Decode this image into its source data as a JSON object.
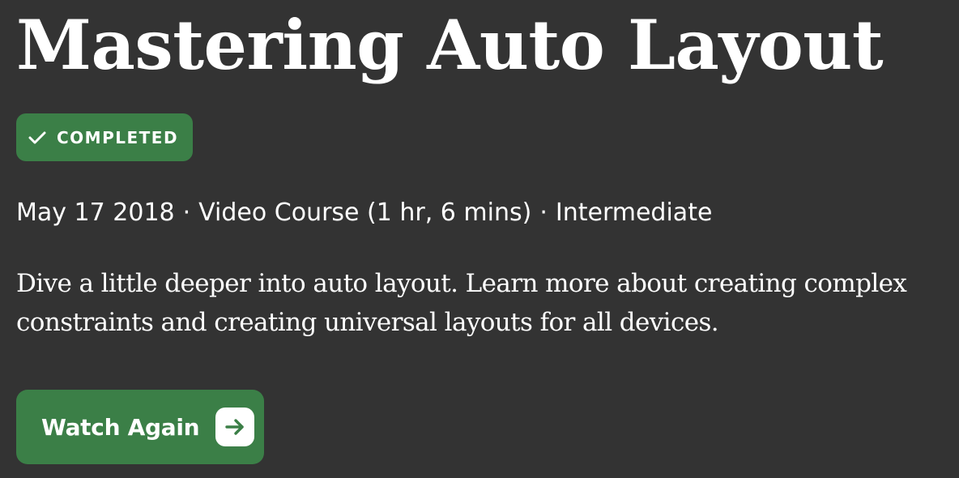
{
  "course": {
    "title": "Mastering Auto Layout",
    "status": {
      "label": "COMPLETED",
      "icon": "checkmark-icon",
      "color": "#3b7f47"
    },
    "meta": {
      "date": "May 17 2018",
      "format": "Video Course (1 hr, 6 mins)",
      "level": "Intermediate",
      "separator": "·"
    },
    "description": "Dive a little deeper into auto layout. Learn more about creating complex constraints and creating universal layouts for all devices.",
    "action": {
      "label": "Watch Again",
      "icon": "arrow-right-icon",
      "color": "#3b7f47"
    }
  },
  "theme": {
    "background": "#333333",
    "text": "#ffffff",
    "accent": "#3b7f47"
  }
}
